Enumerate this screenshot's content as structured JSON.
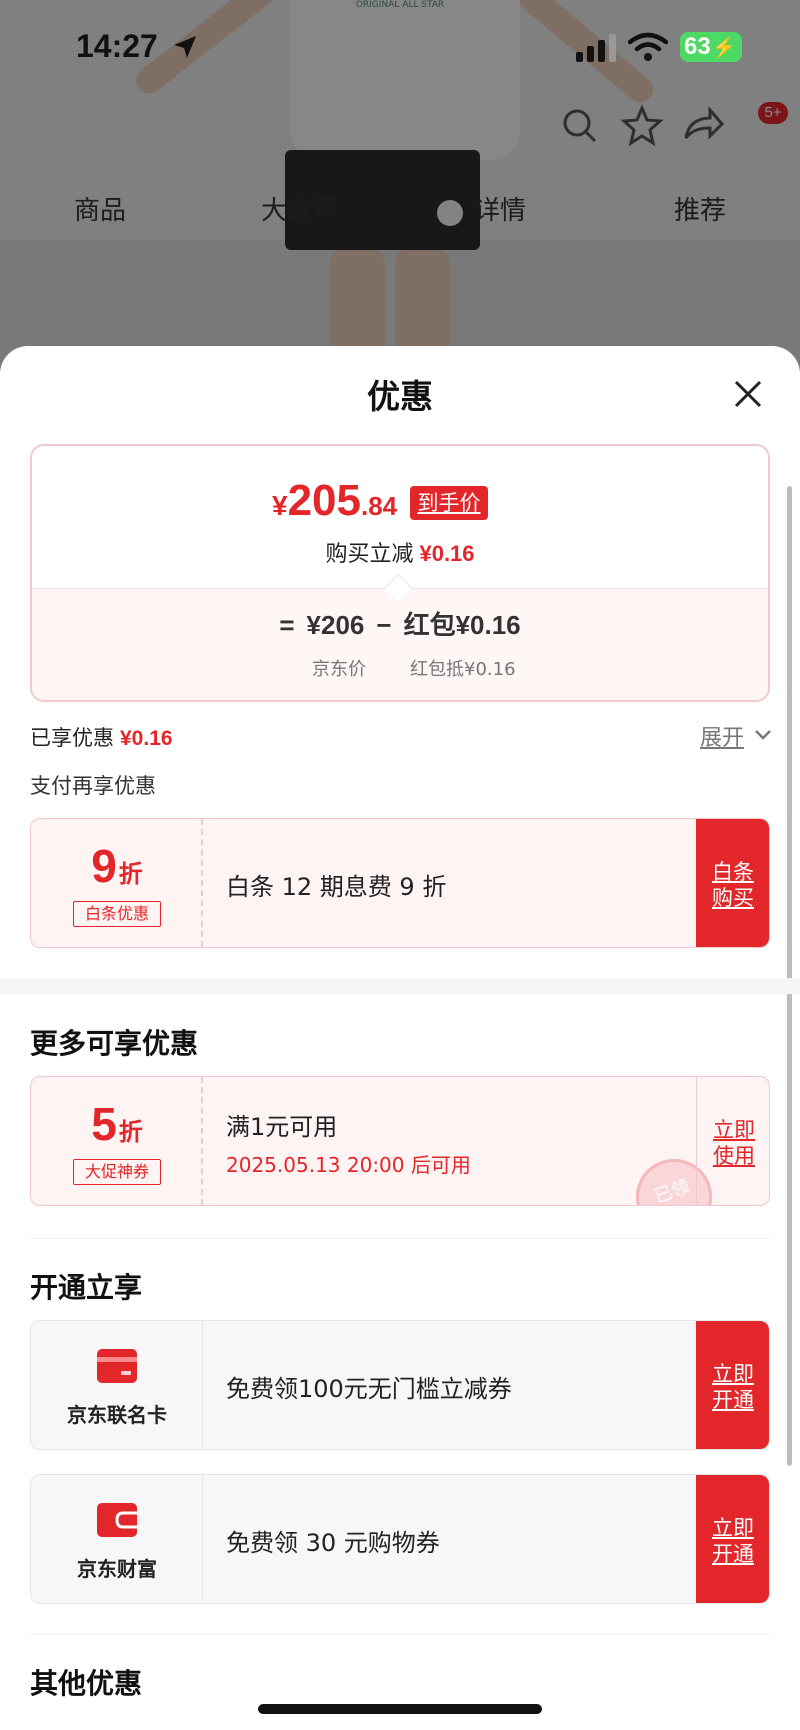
{
  "status_bar": {
    "time": "14:27",
    "battery": "63"
  },
  "product_page": {
    "cart_badge": "5+",
    "tabs": [
      "商品",
      "大家评",
      "详情",
      "推荐"
    ],
    "shirt_print": "ORIGINAL ALL STAR"
  },
  "sheet": {
    "title": "优惠",
    "price": {
      "currency": "¥",
      "integer": "205",
      "decimal": ".84",
      "tag": "到手价",
      "reduce_label": "购买立减",
      "reduce_value": "¥0.16",
      "formula": {
        "equals": "=",
        "base": "¥206",
        "minus": "−",
        "deduct": "红包¥0.16"
      },
      "base_caption": "京东价",
      "deduct_caption": "红包抵¥0.16"
    },
    "enjoyed_label": "已享优惠",
    "enjoyed_value": "¥0.16",
    "expand_label": "展开",
    "pay_more_label": "支付再享优惠",
    "baitiao_coupon": {
      "discount": "9",
      "unit": "折",
      "tag": "白条优惠",
      "text": "白条 12 期息费 9 折",
      "action": "白条购买"
    },
    "more_title": "更多可享优惠",
    "promo_coupon": {
      "discount": "5",
      "unit": "折",
      "tag": "大促神券",
      "text": "满1元可用",
      "sub": "2025.05.13 20:00 后可用",
      "action": "立即使用",
      "stamp": "已领"
    },
    "open_title": "开通立享",
    "open_items": [
      {
        "label": "京东联名卡",
        "icon": "card-icon",
        "text": "免费领100元无门槛立减券",
        "action": "立即开通",
        "color": "#e3262a"
      },
      {
        "label": "京东财富",
        "icon": "wallet-icon",
        "text": "免费领 30 元购物券",
        "action": "立即开通",
        "color": "#e3262a"
      }
    ],
    "other_title": "其他优惠"
  },
  "colors": {
    "accent": "#e3262a",
    "coupon_bg": "#fff4f4"
  }
}
